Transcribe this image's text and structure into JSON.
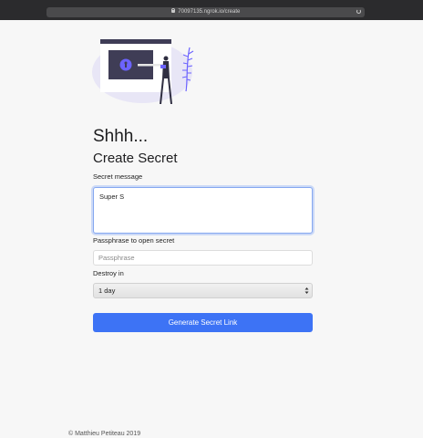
{
  "browser": {
    "url": "70097135.ngrok.io/create"
  },
  "main": {
    "title": "Shhh...",
    "subtitle": "Create Secret",
    "secret_message_label": "Secret message",
    "secret_message_value": "Super S",
    "passphrase_label": "Passphrase to open secret",
    "passphrase_placeholder": "Passphrase",
    "destroy_label": "Destroy in",
    "destroy_selected": "1 day",
    "generate_button": "Generate Secret Link"
  },
  "footer": {
    "copyright": "© Matthieu Petiteau 2019"
  },
  "colors": {
    "accent": "#3d73f5",
    "page_background": "#f7f7f7",
    "chrome_background": "#2b2b2d"
  },
  "icons": {
    "url_lock": "lock-icon",
    "url_reload": "reload-icon",
    "select_arrows": "chevron-updown-icon"
  }
}
